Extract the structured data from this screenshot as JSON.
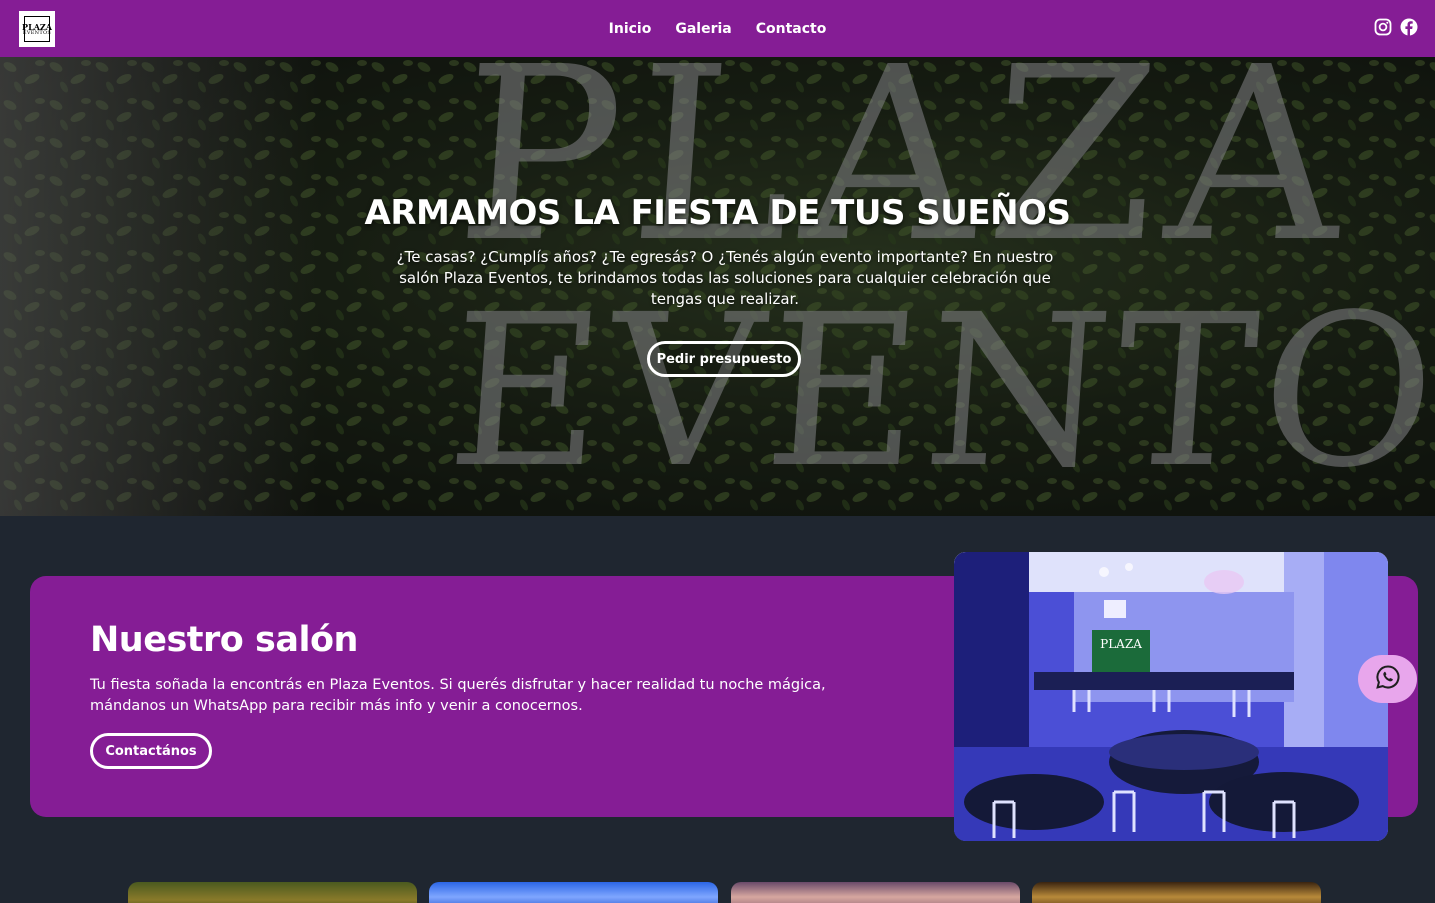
{
  "brand": {
    "logo_top": "PLAZA",
    "logo_bottom": "EVENTOS"
  },
  "nav": {
    "items": [
      {
        "label": "Inicio"
      },
      {
        "label": "Galeria"
      },
      {
        "label": "Contacto"
      }
    ]
  },
  "social": {
    "icons": [
      "instagram-icon",
      "facebook-icon"
    ]
  },
  "hero": {
    "background_letters_line1": "PLAZA",
    "background_letters_line2": "EVENTOS",
    "title": "ARMAMOS LA FIESTA DE TUS SUEÑOS",
    "text": "¿Te casas? ¿Cumplís años? ¿Te egresás? O ¿Tenés algún evento importante? En nuestro salón Plaza Eventos, te brindamos todas las soluciones para cualquier celebración que tengas que realizar.",
    "button_label": "Pedir presupuesto"
  },
  "salon": {
    "title": "Nuestro salón",
    "text": "Tu fiesta soñada la encontrás en Plaza Eventos. Si querés disfrutar y hacer realidad tu noche mágica, mándanos un WhatsApp para recibir más info y venir a conocernos.",
    "button_label": "Contactános",
    "photo_sign": "PLAZA"
  },
  "whatsapp": {
    "icon": "whatsapp-icon"
  },
  "colors": {
    "primary": "#851d95",
    "background": "#1f2630",
    "whatsapp_bg": "#e8a6ec"
  }
}
